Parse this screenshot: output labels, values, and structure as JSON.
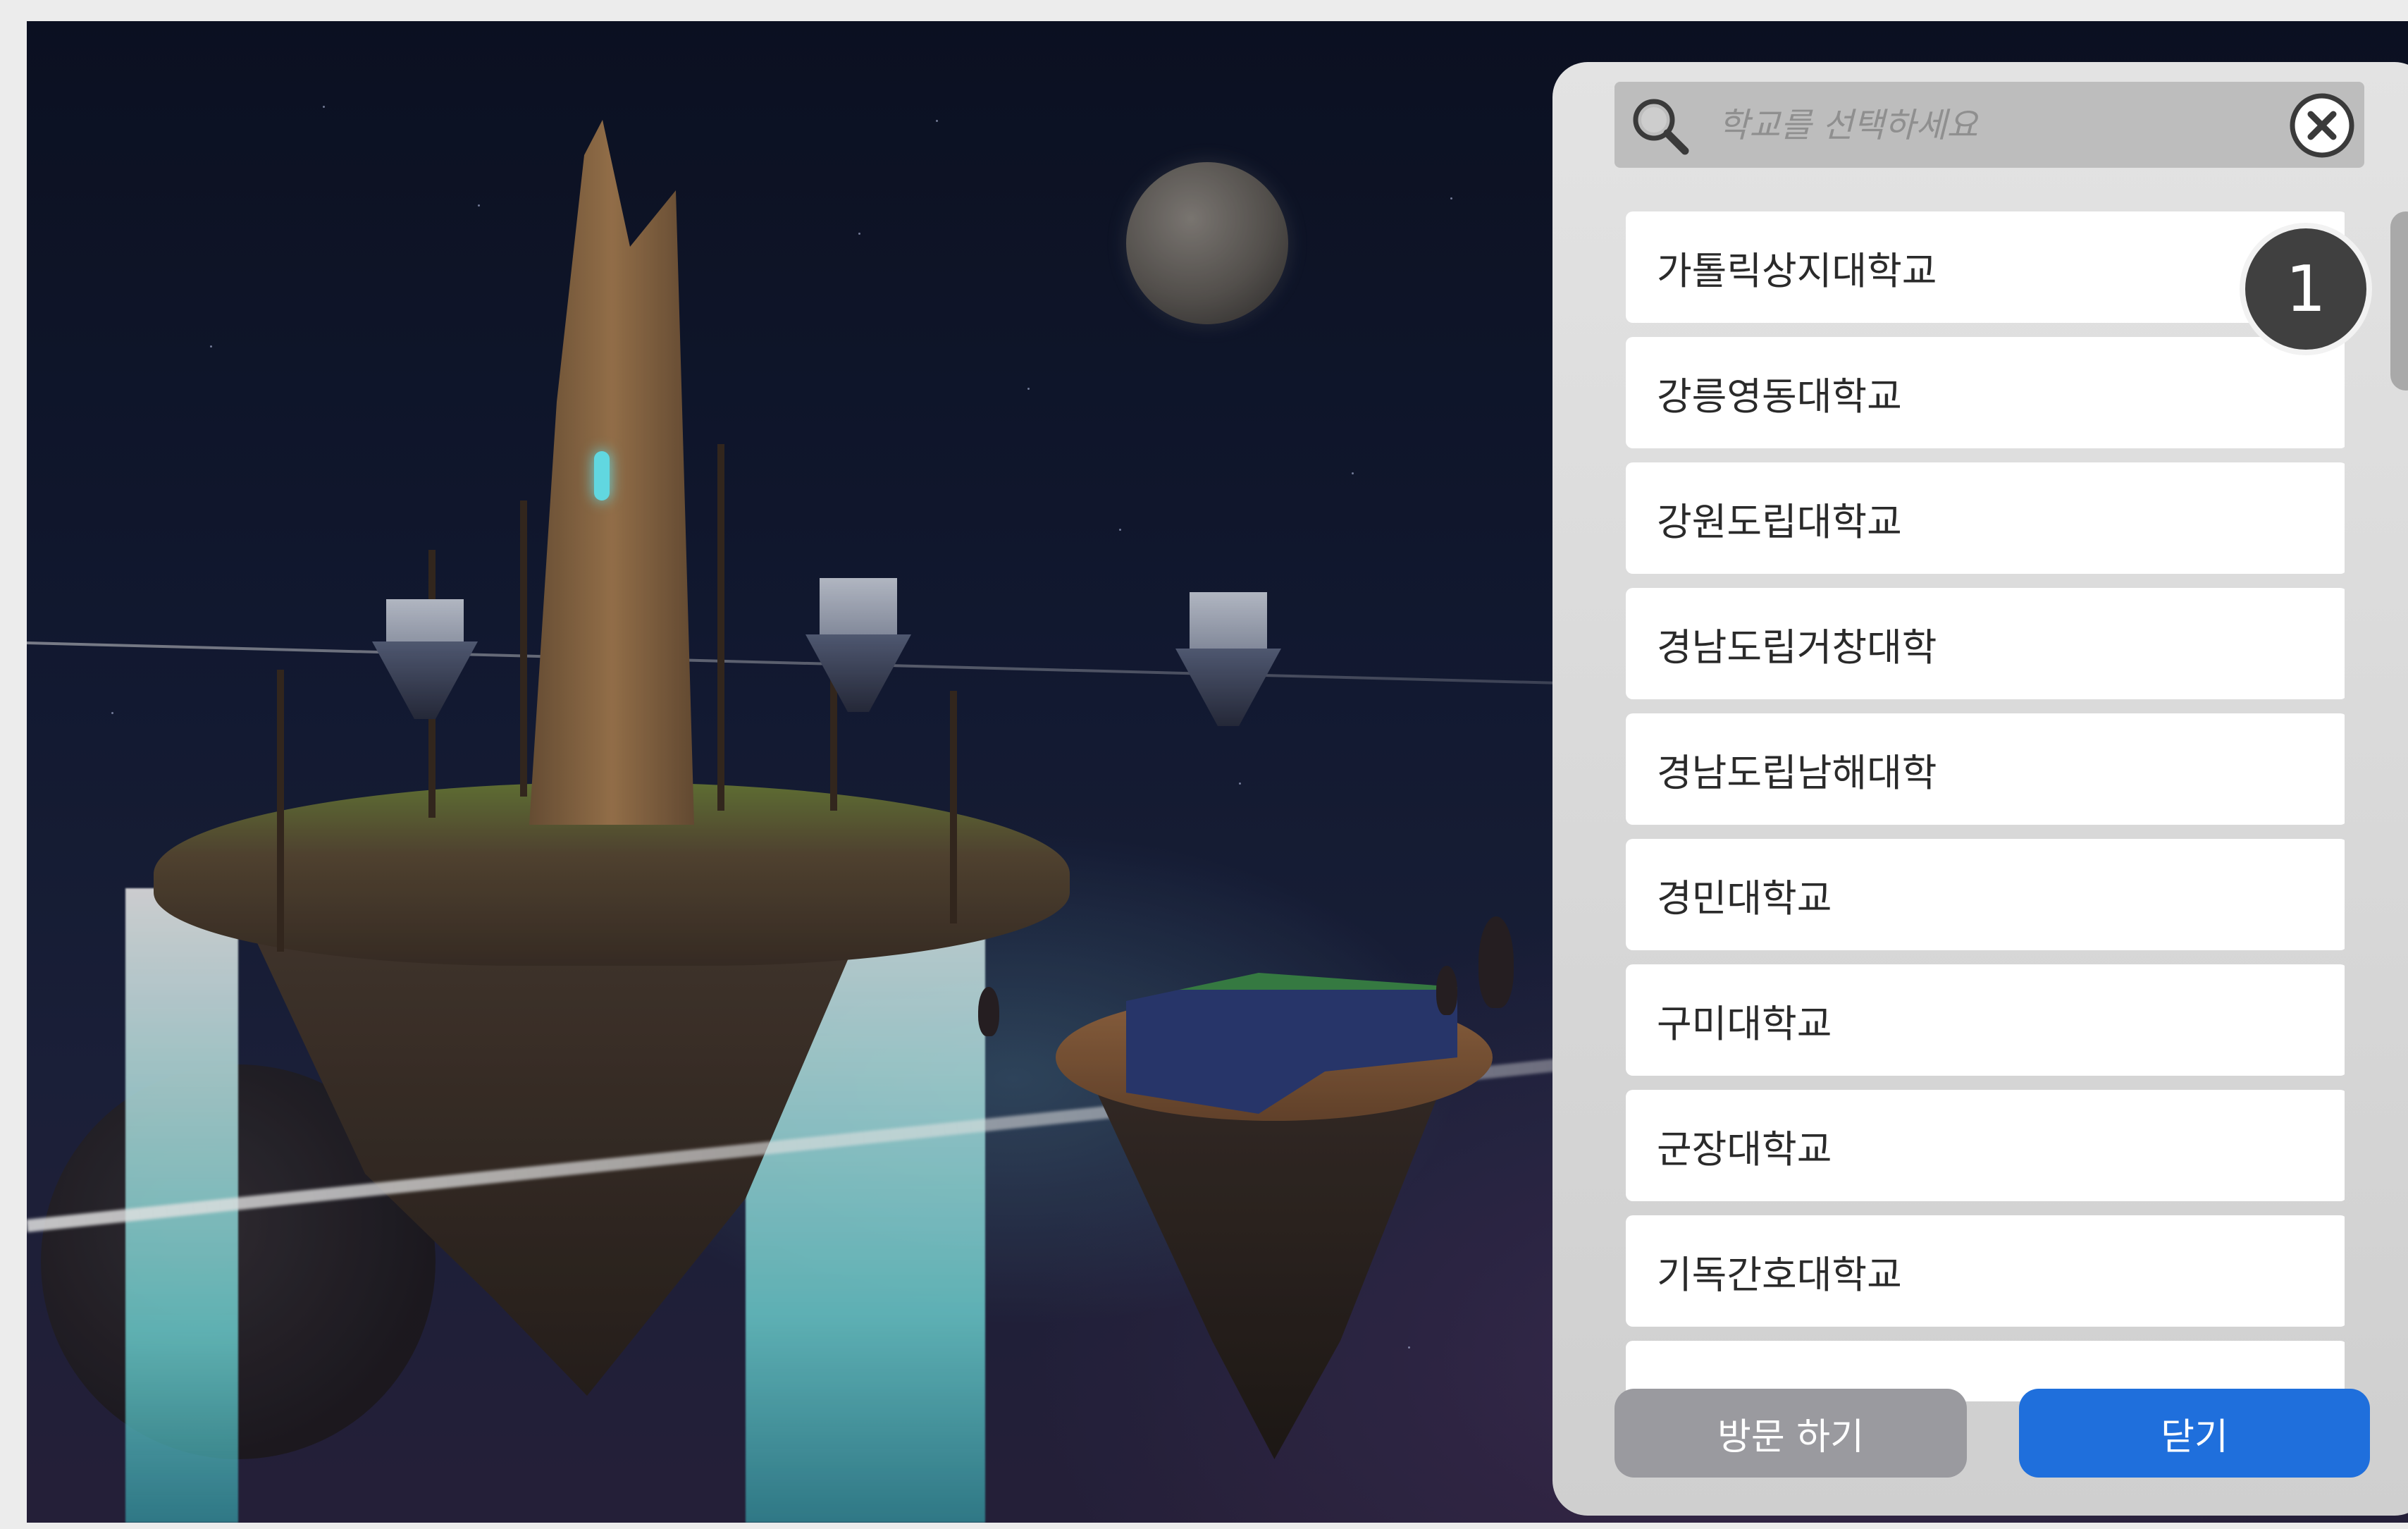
{
  "search": {
    "placeholder": "학교를 선택하세요"
  },
  "schools": [
    "가톨릭상지대학교",
    "강릉영동대학교",
    "강원도립대학교",
    "경남도립거창대학",
    "경남도립남해대학",
    "경민대학교",
    "구미대학교",
    "군장대학교",
    "기독간호대학교",
    ""
  ],
  "step_badge": "1",
  "buttons": {
    "visit_label": "방문 하기",
    "close_label": "닫기"
  },
  "colors": {
    "close_button": "#1f6fdc",
    "visit_button": "#9a9a9f",
    "badge": "#404040"
  }
}
